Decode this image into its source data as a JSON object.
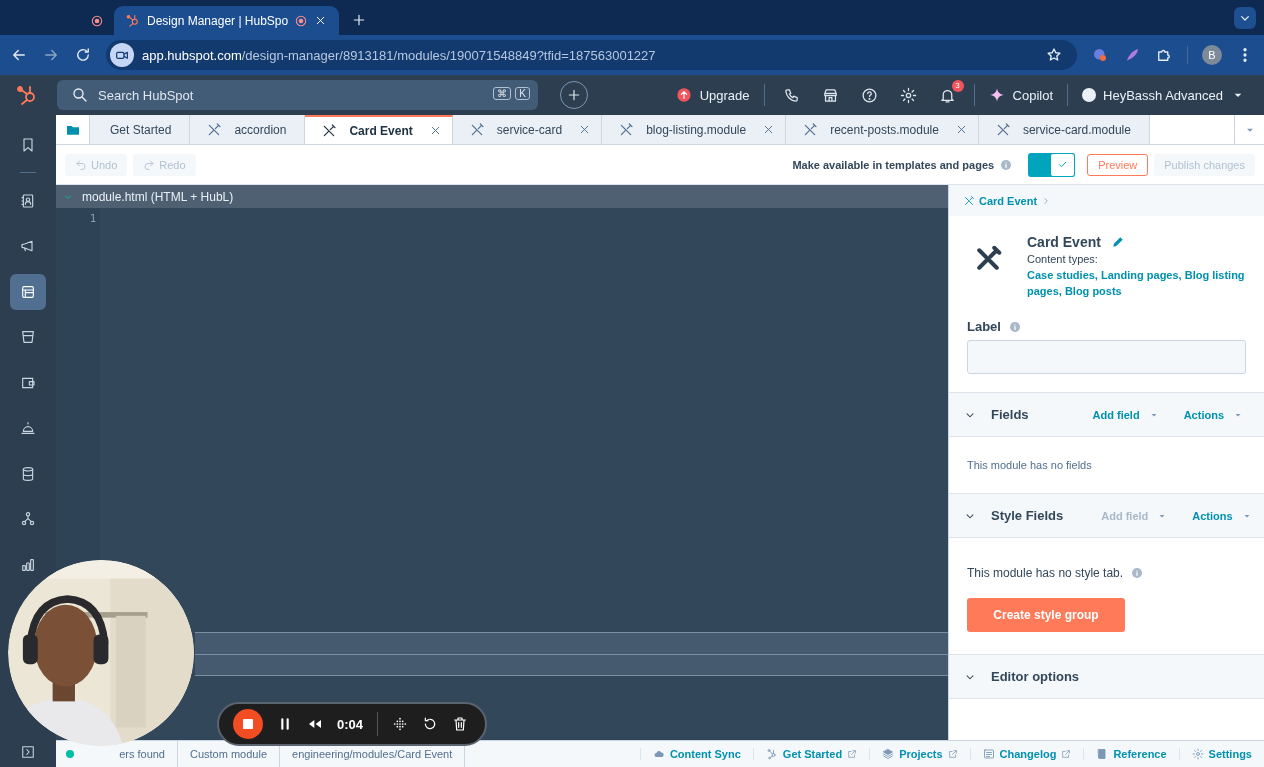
{
  "browser": {
    "tabs": [
      {
        "recording": true,
        "selected": false
      },
      {
        "title": "Design Manager | HubSpo",
        "recording": true,
        "selected": true
      }
    ],
    "url": {
      "domain": "app.hubspot.com",
      "path": "/design-manager/8913181/modules/190071548849?tfid=187563001227"
    },
    "profile": "B"
  },
  "topnav": {
    "search": {
      "placeholder": "Search HubSpot",
      "keys": [
        "⌘",
        "K"
      ]
    },
    "upgrade": "Upgrade",
    "notifications": "3",
    "copilot": "Copilot",
    "account": "HeyBassh Advanced"
  },
  "sidebar": {
    "items": [
      {
        "kind": "bookmark",
        "selected": false
      },
      {
        "kind": "contacts",
        "selected": false
      },
      {
        "kind": "megaphone",
        "selected": false
      },
      {
        "kind": "design",
        "selected": true
      },
      {
        "kind": "cup",
        "selected": false
      },
      {
        "kind": "wallet",
        "selected": false
      },
      {
        "kind": "bell",
        "selected": false
      },
      {
        "kind": "database",
        "selected": false
      },
      {
        "kind": "network",
        "selected": false
      },
      {
        "kind": "chart",
        "selected": false
      }
    ]
  },
  "file_tabs": [
    {
      "label": "Get Started",
      "kind": "start",
      "selected": false,
      "closable": false
    },
    {
      "label": "accordion",
      "kind": "module",
      "selected": false,
      "closable": false
    },
    {
      "label": "Card Event",
      "kind": "module",
      "selected": true,
      "closable": true
    },
    {
      "label": "service-card",
      "kind": "module",
      "selected": false,
      "closable": true
    },
    {
      "label": "blog-listing.module",
      "kind": "module",
      "selected": false,
      "closable": true
    },
    {
      "label": "recent-posts.module",
      "kind": "module",
      "selected": false,
      "closable": true
    },
    {
      "label": "service-card.module",
      "kind": "module",
      "selected": false,
      "closable": false
    }
  ],
  "toolbar": {
    "undo": {
      "label": "Undo",
      "disabled": true
    },
    "redo": {
      "label": "Redo",
      "disabled": true
    },
    "availability": {
      "label": "Make available in templates and pages",
      "on": true
    },
    "preview": "Preview",
    "publish": {
      "label": "Publish changes",
      "disabled": true
    }
  },
  "editor": {
    "file": "module.html (HTML + HubL)",
    "expanded": true,
    "line_numbers": [
      "1"
    ]
  },
  "panel": {
    "breadcrumb": "Card Event",
    "title": "Card Event",
    "content_types_label": "Content types:",
    "content_types": "Case studies, Landing pages, Blog listing pages, Blog posts",
    "label_field": "Label",
    "sections": [
      {
        "title": "Fields",
        "expanded": true,
        "add_field": {
          "label": "Add field",
          "disabled": false
        },
        "actions": "Actions",
        "message": "This module has no fields"
      },
      {
        "title": "Style Fields",
        "expanded": true,
        "add_field": {
          "label": "Add field",
          "disabled": true
        },
        "actions": "Actions",
        "message": "This module has no style tab.",
        "info": true,
        "button": "Create style group"
      },
      {
        "title": "Editor options",
        "expanded": true
      }
    ]
  },
  "status_bar": {
    "left": [
      {
        "text": "ers found",
        "color": "#00bda5"
      },
      {
        "text": "Custom module"
      },
      {
        "text": "engineering/modules/Card Event"
      }
    ],
    "links": [
      {
        "label": "Content Sync",
        "kind": "cloud",
        "external": false
      },
      {
        "label": "Get Started",
        "kind": "hub",
        "external": true
      },
      {
        "label": "Projects",
        "kind": "layers",
        "external": true
      },
      {
        "label": "Changelog",
        "kind": "log",
        "external": true
      },
      {
        "label": "Reference",
        "kind": "book",
        "external": false
      },
      {
        "label": "Settings",
        "kind": "gear",
        "external": false
      }
    ]
  },
  "recorder": {
    "time": "0:04"
  }
}
